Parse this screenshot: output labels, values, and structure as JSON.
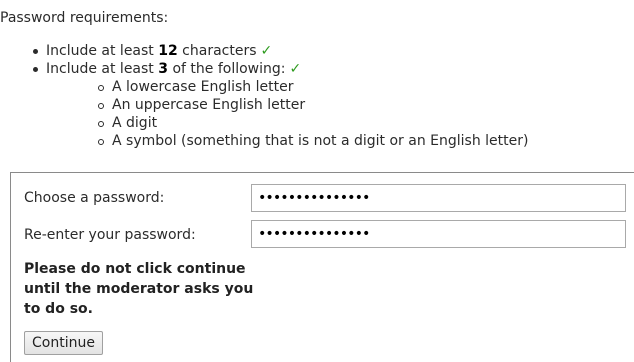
{
  "requirements": {
    "heading": "Password requirements:",
    "items": [
      {
        "before": "Include at least ",
        "number": "12",
        "after": " characters",
        "check": "✓"
      },
      {
        "before": "Include at least ",
        "number": "3",
        "after": " of the following:",
        "check": "✓"
      }
    ],
    "sub_items": [
      "A lowercase English letter",
      "An uppercase English letter",
      "A digit",
      "A symbol (something that is not a digit or an English letter)"
    ],
    "check_color": "#2e9b1f"
  },
  "form": {
    "choose_label": "Choose a password:",
    "choose_value": "•••••••••••••••",
    "reenter_label": "Re-enter your password:",
    "reenter_value": "•••••••••••••••",
    "warning": "Please do not click continue until the moderator asks you to do so.",
    "continue_label": "Continue"
  }
}
